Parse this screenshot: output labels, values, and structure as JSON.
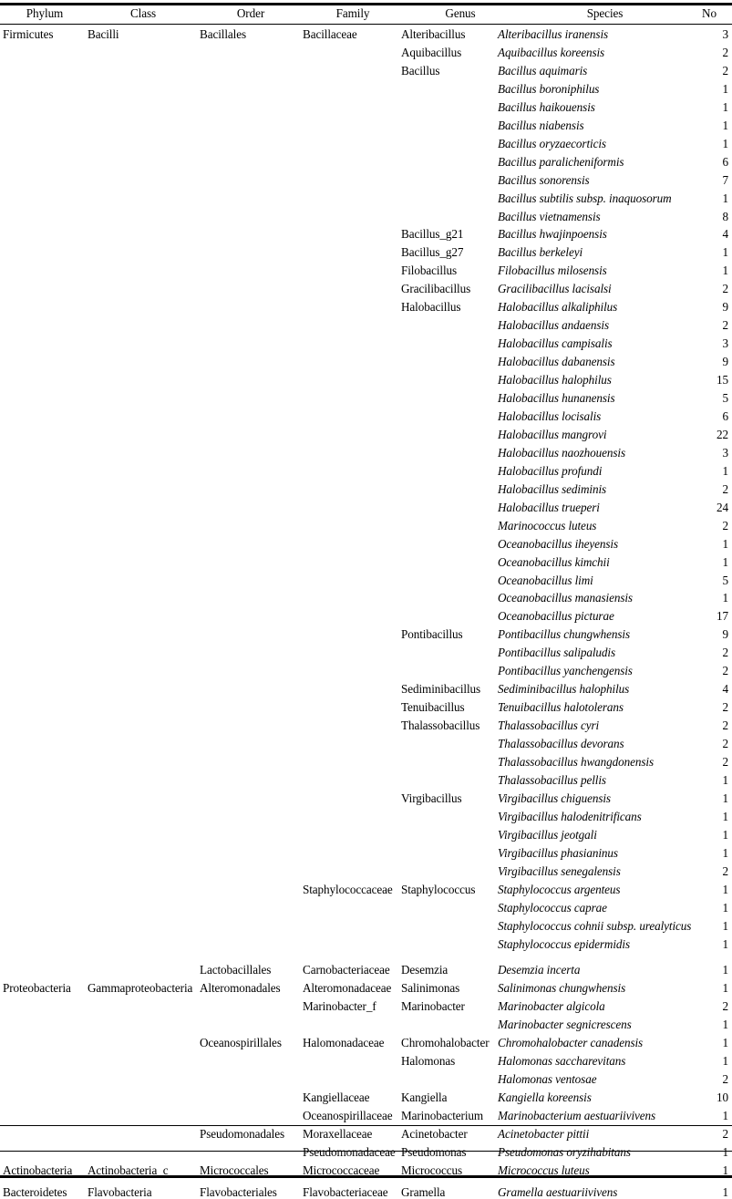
{
  "table": {
    "headers": [
      "Phylum",
      "Class",
      "Order",
      "Family",
      "Genus",
      "Species",
      "No"
    ],
    "rows": [
      {
        "phylum": "Firmicutes",
        "class": "Bacilli",
        "order": "Bacillales",
        "family": "Bacillaceae",
        "genus": "Alteribacillus",
        "species": "Alteribacillus iranensis",
        "no": "3"
      },
      {
        "phylum": "",
        "class": "",
        "order": "",
        "family": "",
        "genus": "Aquibacillus",
        "species": "Aquibacillus koreensis",
        "no": "2"
      },
      {
        "phylum": "",
        "class": "",
        "order": "",
        "family": "",
        "genus": "Bacillus",
        "species": "Bacillus aquimaris",
        "no": "2"
      },
      {
        "phylum": "",
        "class": "",
        "order": "",
        "family": "",
        "genus": "",
        "species": "Bacillus boroniphilus",
        "no": "1"
      },
      {
        "phylum": "",
        "class": "",
        "order": "",
        "family": "",
        "genus": "",
        "species": "Bacillus haikouensis",
        "no": "1"
      },
      {
        "phylum": "",
        "class": "",
        "order": "",
        "family": "",
        "genus": "",
        "species": "Bacillus niabensis",
        "no": "1"
      },
      {
        "phylum": "",
        "class": "",
        "order": "",
        "family": "",
        "genus": "",
        "species": "Bacillus oryzaecorticis",
        "no": "1"
      },
      {
        "phylum": "",
        "class": "",
        "order": "",
        "family": "",
        "genus": "",
        "species": "Bacillus paralicheniformis",
        "no": "6"
      },
      {
        "phylum": "",
        "class": "",
        "order": "",
        "family": "",
        "genus": "",
        "species": "Bacillus sonorensis",
        "no": "7"
      },
      {
        "phylum": "",
        "class": "",
        "order": "",
        "family": "",
        "genus": "",
        "species": "Bacillus subtilis subsp. inaquosorum",
        "no": "1"
      },
      {
        "phylum": "",
        "class": "",
        "order": "",
        "family": "",
        "genus": "",
        "species": "Bacillus vietnamensis",
        "no": "8"
      },
      {
        "phylum": "",
        "class": "",
        "order": "",
        "family": "",
        "genus": "Bacillus_g21",
        "species": "Bacillus hwajinpoensis",
        "no": "4"
      },
      {
        "phylum": "",
        "class": "",
        "order": "",
        "family": "",
        "genus": "Bacillus_g27",
        "species": "Bacillus berkeleyi",
        "no": "1"
      },
      {
        "phylum": "",
        "class": "",
        "order": "",
        "family": "",
        "genus": "Filobacillus",
        "species": "Filobacillus milosensis",
        "no": "1"
      },
      {
        "phylum": "",
        "class": "",
        "order": "",
        "family": "",
        "genus": "Gracilibacillus",
        "species": "Gracilibacillus lacisalsi",
        "no": "2"
      },
      {
        "phylum": "",
        "class": "",
        "order": "",
        "family": "",
        "genus": "Halobacillus",
        "species": "Halobacillus alkaliphilus",
        "no": "9"
      },
      {
        "phylum": "",
        "class": "",
        "order": "",
        "family": "",
        "genus": "",
        "species": "Halobacillus andaensis",
        "no": "2"
      },
      {
        "phylum": "",
        "class": "",
        "order": "",
        "family": "",
        "genus": "",
        "species": "Halobacillus campisalis",
        "no": "3"
      },
      {
        "phylum": "",
        "class": "",
        "order": "",
        "family": "",
        "genus": "",
        "species": "Halobacillus dabanensis",
        "no": "9"
      },
      {
        "phylum": "",
        "class": "",
        "order": "",
        "family": "",
        "genus": "",
        "species": "Halobacillus halophilus",
        "no": "15"
      },
      {
        "phylum": "",
        "class": "",
        "order": "",
        "family": "",
        "genus": "",
        "species": "Halobacillus hunanensis",
        "no": "5"
      },
      {
        "phylum": "",
        "class": "",
        "order": "",
        "family": "",
        "genus": "",
        "species": "Halobacillus locisalis",
        "no": "6"
      },
      {
        "phylum": "",
        "class": "",
        "order": "",
        "family": "",
        "genus": "",
        "species": "Halobacillus mangrovi",
        "no": "22"
      },
      {
        "phylum": "",
        "class": "",
        "order": "",
        "family": "",
        "genus": "",
        "species": "Halobacillus naozhouensis",
        "no": "3"
      },
      {
        "phylum": "",
        "class": "",
        "order": "",
        "family": "",
        "genus": "",
        "species": "Halobacillus profundi",
        "no": "1"
      },
      {
        "phylum": "",
        "class": "",
        "order": "",
        "family": "",
        "genus": "",
        "species": "Halobacillus sediminis",
        "no": "2"
      },
      {
        "phylum": "",
        "class": "",
        "order": "",
        "family": "",
        "genus": "",
        "species": "Halobacillus trueperi",
        "no": "24"
      },
      {
        "phylum": "",
        "class": "",
        "order": "",
        "family": "",
        "genus": "",
        "species": "Marinococcus luteus",
        "no": "2"
      },
      {
        "phylum": "",
        "class": "",
        "order": "",
        "family": "",
        "genus": "",
        "species": "Oceanobacillus iheyensis",
        "no": "1"
      },
      {
        "phylum": "",
        "class": "",
        "order": "",
        "family": "",
        "genus": "",
        "species": "Oceanobacillus kimchii",
        "no": "1"
      },
      {
        "phylum": "",
        "class": "",
        "order": "",
        "family": "",
        "genus": "",
        "species": "Oceanobacillus limi",
        "no": "5"
      },
      {
        "phylum": "",
        "class": "",
        "order": "",
        "family": "",
        "genus": "",
        "species": "Oceanobacillus manasiensis",
        "no": "1"
      },
      {
        "phylum": "",
        "class": "",
        "order": "",
        "family": "",
        "genus": "",
        "species": "Oceanobacillus picturae",
        "no": "17"
      },
      {
        "phylum": "",
        "class": "",
        "order": "",
        "family": "",
        "genus": "Pontibacillus",
        "species": "Pontibacillus chungwhensis",
        "no": "9"
      },
      {
        "phylum": "",
        "class": "",
        "order": "",
        "family": "",
        "genus": "",
        "species": "Pontibacillus salipaludis",
        "no": "2"
      },
      {
        "phylum": "",
        "class": "",
        "order": "",
        "family": "",
        "genus": "",
        "species": "Pontibacillus yanchengensis",
        "no": "2"
      },
      {
        "phylum": "",
        "class": "",
        "order": "",
        "family": "",
        "genus": "Sediminibacillus",
        "species": "Sediminibacillus halophilus",
        "no": "4"
      },
      {
        "phylum": "",
        "class": "",
        "order": "",
        "family": "",
        "genus": "Tenuibacillus",
        "species": "Tenuibacillus halotolerans",
        "no": "2"
      },
      {
        "phylum": "",
        "class": "",
        "order": "",
        "family": "",
        "genus": "Thalassobacillus",
        "species": "Thalassobacillus cyri",
        "no": "2"
      },
      {
        "phylum": "",
        "class": "",
        "order": "",
        "family": "",
        "genus": "",
        "species": "Thalassobacillus devorans",
        "no": "2"
      },
      {
        "phylum": "",
        "class": "",
        "order": "",
        "family": "",
        "genus": "",
        "species": "Thalassobacillus hwangdonensis",
        "no": "2"
      },
      {
        "phylum": "",
        "class": "",
        "order": "",
        "family": "",
        "genus": "",
        "species": "Thalassobacillus pellis",
        "no": "1"
      },
      {
        "phylum": "",
        "class": "",
        "order": "",
        "family": "",
        "genus": "Virgibacillus",
        "species": "Virgibacillus chiguensis",
        "no": "1"
      },
      {
        "phylum": "",
        "class": "",
        "order": "",
        "family": "",
        "genus": "",
        "species": "Virgibacillus halodenitrificans",
        "no": "1"
      },
      {
        "phylum": "",
        "class": "",
        "order": "",
        "family": "",
        "genus": "",
        "species": "Virgibacillus jeotgali",
        "no": "1"
      },
      {
        "phylum": "",
        "class": "",
        "order": "",
        "family": "",
        "genus": "",
        "species": "Virgibacillus phasianinus",
        "no": "1"
      },
      {
        "phylum": "",
        "class": "",
        "order": "",
        "family": "",
        "genus": "",
        "species": "Virgibacillus senegalensis",
        "no": "2"
      },
      {
        "phylum": "",
        "class": "",
        "order": "",
        "family": "Staphylococcaceae",
        "genus": "Staphylococcus",
        "species": "Staphylococcus argenteus",
        "no": "1"
      },
      {
        "phylum": "",
        "class": "",
        "order": "",
        "family": "",
        "genus": "",
        "species": "Staphylococcus caprae",
        "no": "1"
      },
      {
        "phylum": "",
        "class": "",
        "order": "",
        "family": "",
        "genus": "",
        "species": "Staphylococcus cohnii subsp. urealyticus",
        "no": "1"
      },
      {
        "phylum": "",
        "class": "",
        "order": "",
        "family": "",
        "genus": "",
        "species": "Staphylococcus epidermidis",
        "no": "1"
      },
      {
        "phylum": "",
        "class": "",
        "order": "Lactobacillales",
        "family": "Carnobacteriaceae",
        "genus": "Desemzia",
        "species": "Desemzia incerta",
        "no": "1"
      },
      {
        "phylum": "Proteobacteria",
        "class": "Gammaproteobacteria",
        "order": "Alteromonadales",
        "family": "Alteromonadaceae",
        "genus": "Salinimonas",
        "species": "Salinimonas chungwhensis",
        "no": "1"
      },
      {
        "phylum": "",
        "class": "",
        "order": "",
        "family": "Marinobacter_f",
        "genus": "Marinobacter",
        "species": "Marinobacter algicola",
        "no": "2"
      },
      {
        "phylum": "",
        "class": "",
        "order": "",
        "family": "",
        "genus": "",
        "species": "Marinobacter segnicrescens",
        "no": "1"
      },
      {
        "phylum": "",
        "class": "",
        "order": "Oceanospirillales",
        "family": "Halomonadaceae",
        "genus": "Chromohalobacter",
        "species": "Chromohalobacter canadensis",
        "no": "1"
      },
      {
        "phylum": "",
        "class": "",
        "order": "",
        "family": "",
        "genus": "Halomonas",
        "species": "Halomonas saccharevitans",
        "no": "1"
      },
      {
        "phylum": "",
        "class": "",
        "order": "",
        "family": "",
        "genus": "",
        "species": "Halomonas ventosae",
        "no": "2"
      },
      {
        "phylum": "",
        "class": "",
        "order": "",
        "family": "Kangiellaceae",
        "genus": "Kangiella",
        "species": "Kangiella koreensis",
        "no": "10"
      },
      {
        "phylum": "",
        "class": "",
        "order": "",
        "family": "Oceanospirillaceae",
        "genus": "Marinobacterium",
        "species": "Marinobacterium aestuariivivens",
        "no": "1"
      },
      {
        "phylum": "",
        "class": "",
        "order": "Pseudomonadales",
        "family": "Moraxellaceae",
        "genus": "Acinetobacter",
        "species": "Acinetobacter pittii",
        "no": "2"
      },
      {
        "phylum": "",
        "class": "",
        "order": "",
        "family": "Pseudomonadaceae",
        "genus": "Pseudomonas",
        "species": "Pseudomonas oryzihabitans",
        "no": "1"
      },
      {
        "phylum": "Actinobacteria",
        "class": "Actinobacteria_c",
        "order": "Micrococcales",
        "family": "Micrococcaceae",
        "genus": "Micrococcus",
        "species": "Micrococcus luteus",
        "no": "1"
      },
      {
        "phylum": "Bacteroidetes",
        "class": "Flavobacteria",
        "order": "Flavobacteriales",
        "family": "Flavobacteriaceae",
        "genus": "Gramella",
        "species": "Gramella aestuariivivens",
        "no": "1"
      }
    ]
  }
}
